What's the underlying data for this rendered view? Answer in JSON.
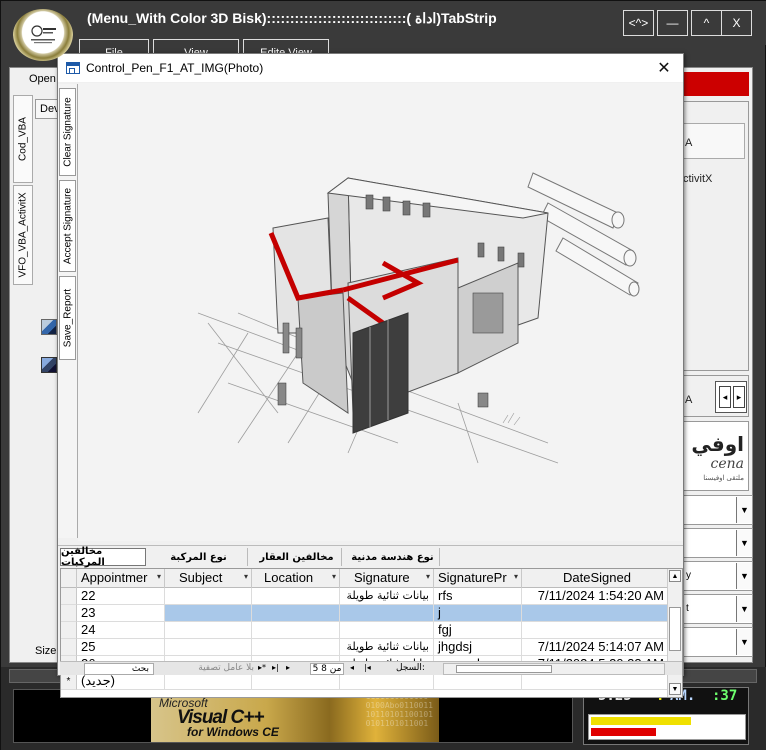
{
  "app": {
    "title": "(Menu_With Color 3D Bisk)::::::::::::::::::::::::::::::( اداة)TabStrip",
    "window_buttons": [
      "<^>",
      "—",
      "^",
      "X"
    ],
    "menu_tabs": [
      "File",
      "View",
      "Edite  View"
    ]
  },
  "background": {
    "open_label": "Open",
    "dev_label": "Dev",
    "left_tabs": [
      "Cod_VBA",
      "VFO_VBA_ActivitX"
    ],
    "size_label": "Size",
    "right_texts": [
      "A",
      "ctivitX",
      "A",
      "y",
      "t"
    ],
    "logo_ar": "اوفي",
    "logo_en": "cena",
    "logo_small": "ملتقى اوفيسنا"
  },
  "form": {
    "title": "Control_Pen_F1_AT_IMG(Photo)",
    "close_label": "✕",
    "side_tabs": [
      "Clear Signature",
      "Accept Signature",
      "Save_Report"
    ],
    "bottom_tabs": [
      "مخالفين المركبات",
      "نوع المركبة",
      "مخالفين العقار",
      "نوع هندسة مدنية"
    ],
    "active_tab": 0
  },
  "grid": {
    "columns": [
      {
        "label": "Appointmer",
        "dropdown": true
      },
      {
        "label": "Subject",
        "dropdown": true
      },
      {
        "label": "Location",
        "dropdown": true
      },
      {
        "label": "Signature",
        "dropdown": true
      },
      {
        "label": "SignaturePr",
        "dropdown": true
      },
      {
        "label": "DateSigned",
        "dropdown": false
      }
    ],
    "rows": [
      {
        "id": "22",
        "subject": "",
        "location": "",
        "signature": "بيانات ثنائية طويلة",
        "sigpr": "rfs",
        "date": "7/11/2024 1:54:20 AM"
      },
      {
        "id": "23",
        "subject": "",
        "location": "",
        "signature": "",
        "sigpr": "j",
        "date": ""
      },
      {
        "id": "24",
        "subject": "",
        "location": "",
        "signature": "",
        "sigpr": "fgj",
        "date": ""
      },
      {
        "id": "25",
        "subject": "",
        "location": "",
        "signature": "بيانات ثنائية طويلة",
        "sigpr": "jhgdsj",
        "date": "7/11/2024 5:14:07 AM"
      },
      {
        "id": "26",
        "subject": "",
        "location": "",
        "signature": "بيانات ثنائية طويلة",
        "sigpr": "moosak",
        "date": "7/11/2024 5:20:23 AM"
      }
    ],
    "new_row_marker": "*",
    "new_row_label": "(جديد)",
    "selected_row": 1
  },
  "navigator": {
    "search_label": "بحث",
    "filter_label": "بلا عامل تصفية",
    "record_label": "السجل:",
    "record_text": "5 ﻣﻦ 8"
  },
  "banner": {
    "line1": "Microsoft",
    "line2": "Visual C++",
    "line3": "for Windows CE",
    "binary": "1101010001100\n0100Abo0110011\n10110101100101\n0101101011001"
  },
  "clock": {
    "time": "5:25",
    "ampm_sep": ":",
    "ampm": "AM.",
    "seconds": ":37",
    "yellow_fraction": 0.66,
    "red_fraction": 0.43
  },
  "colors": {
    "frame": "#3a3a3a",
    "selection": "#a9c8e9",
    "accent_red": "#cc0000"
  }
}
